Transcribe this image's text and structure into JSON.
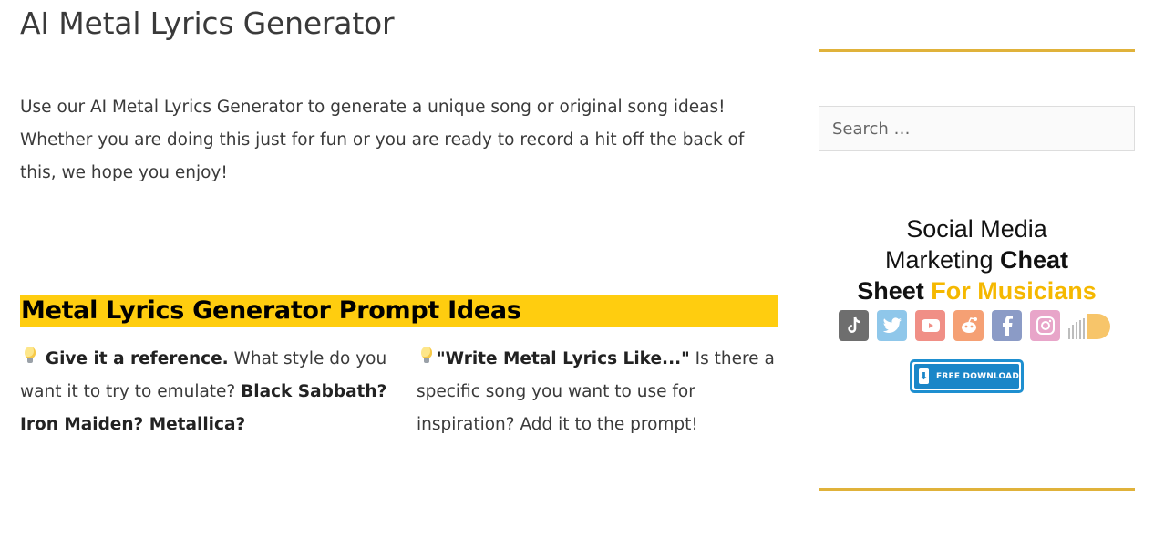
{
  "page": {
    "title": "AI Metal Lyrics Generator",
    "intro": "Use our AI Metal Lyrics Generator to generate a unique song or original song ideas! Whether you are doing this just for fun or you are ready to record a hit off the back of this, we hope you enjoy!"
  },
  "prompt_ideas": {
    "heading": "Metal Lyrics Generator Prompt Ideas",
    "tips": [
      {
        "icon": "lightbulb-icon",
        "lead": "Give it a reference.",
        "text": " What style do you want it to try to emulate? ",
        "examples": "Black Sabbath? Iron Maiden? Metallica?"
      },
      {
        "icon": "lightbulb-icon",
        "lead": "\"Write Metal Lyrics Like...\"",
        "text": " Is there a specific song you want to use for inspiration? Add it to the prompt!"
      }
    ]
  },
  "sidebar": {
    "search": {
      "placeholder": "Search …",
      "value": ""
    },
    "promo": {
      "line1": "Social Media",
      "line2_regular": "Marketing ",
      "line2_bold": "Cheat",
      "line3_bold": "Sheet ",
      "line3_gold": "For Musicians",
      "icons": [
        "tiktok-icon",
        "twitter-icon",
        "youtube-icon",
        "reddit-icon",
        "facebook-icon",
        "instagram-icon",
        "soundcloud-icon"
      ],
      "button_label": "FREE DOWNLOAD"
    },
    "accent_color": "#e0b23a",
    "gold_text_color": "#f5b800",
    "button_color": "#1a86c8"
  },
  "colors": {
    "heading_highlight": "#ffcd0f",
    "body_text": "#3a3a3a"
  }
}
